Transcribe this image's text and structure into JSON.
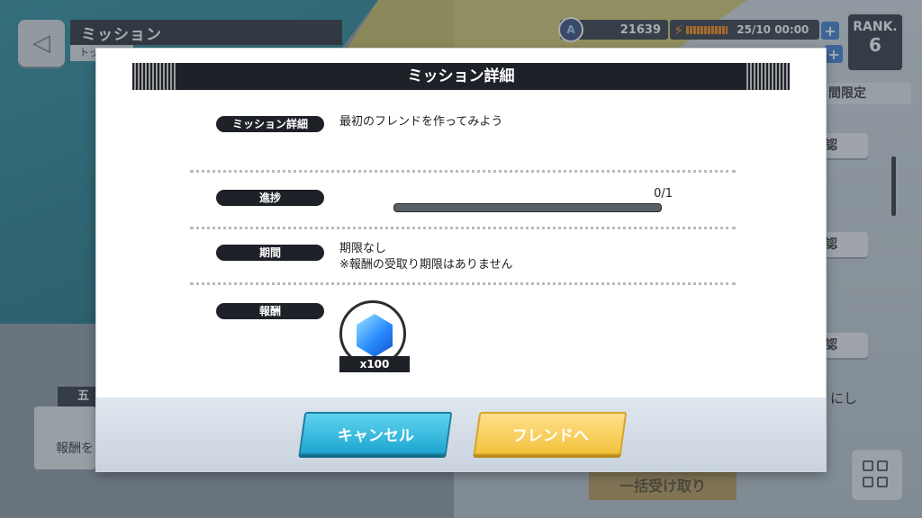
{
  "background": {
    "screen_title": "ミッション",
    "screen_subtitle": "トッ",
    "currency_value": "21639",
    "stamina_text": "25/10  00:00",
    "rank_label": "RANK.",
    "rank_value": "6",
    "side_tab_label": "間限定",
    "side_button_label": "認",
    "side_text": "にし",
    "bulk_receive_label": "一括受け取り",
    "left_badge": "五",
    "left_text": "報酬を",
    "colors": {
      "teal": "#2e8fa0",
      "yellow": "#d8c65a"
    }
  },
  "modal": {
    "title": "ミッション詳細",
    "rows": {
      "detail": {
        "label": "ミッション詳細",
        "text": "最初のフレンドを作ってみよう"
      },
      "progress": {
        "label": "進捗",
        "text": "0/1",
        "fraction": 0
      },
      "period": {
        "label": "期間",
        "line1": "期限なし",
        "line2": "※報酬の受取り期限はありません"
      },
      "reward": {
        "label": "報酬",
        "icon": "blue-gem-icon",
        "quantity": "x100"
      }
    },
    "buttons": {
      "cancel": "キャンセル",
      "friend": "フレンドへ"
    },
    "colors": {
      "cancel": "#1ea6d0",
      "friend": "#f3c23e",
      "header": "#1e2128"
    }
  }
}
